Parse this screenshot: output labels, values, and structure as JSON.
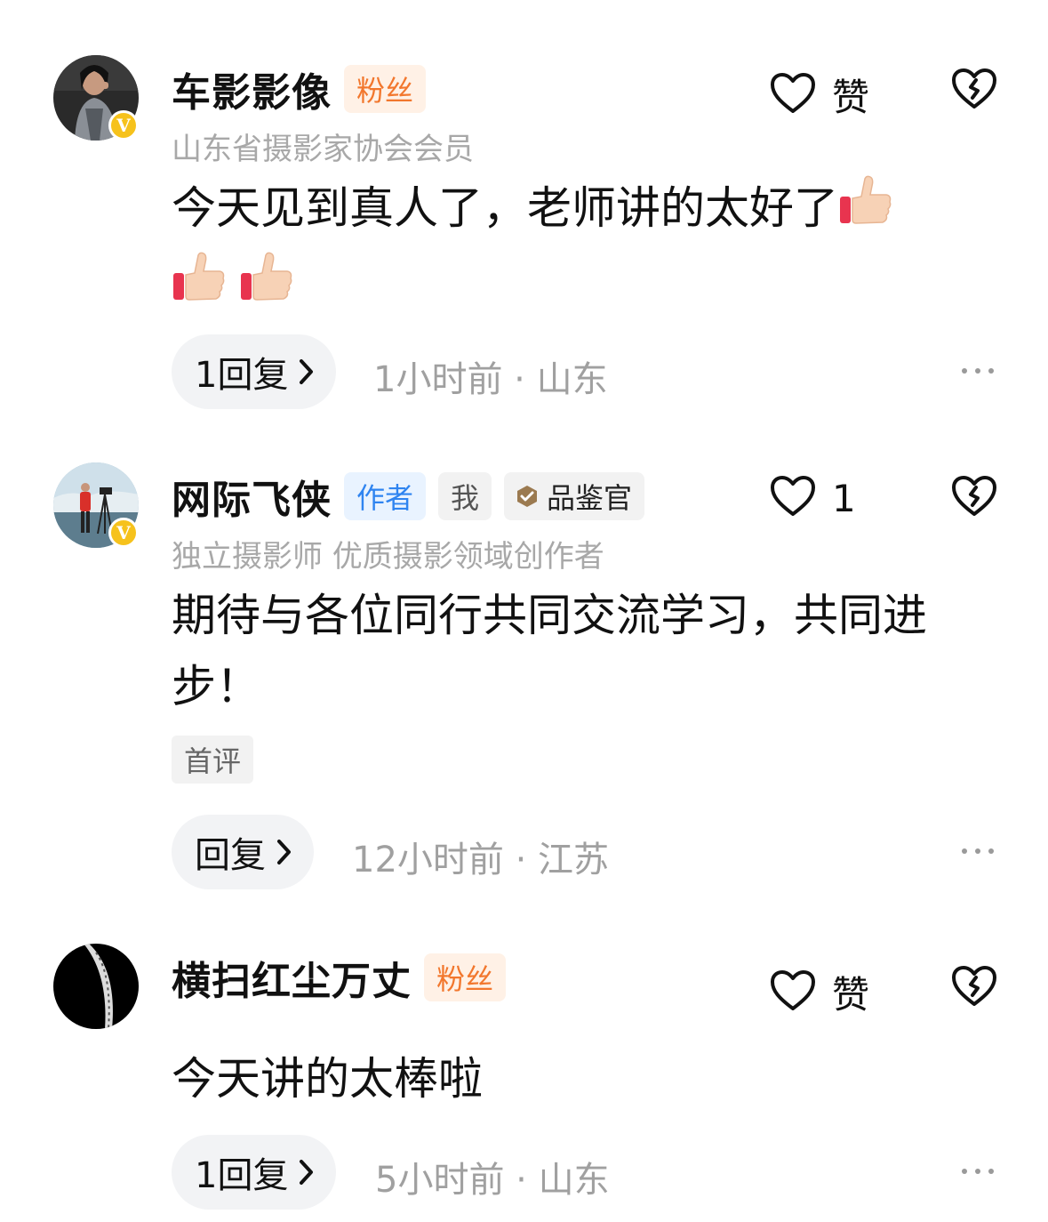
{
  "comments": [
    {
      "username": "车影影像",
      "tags": [
        "粉丝"
      ],
      "subtitle": "山东省摄影家协会会员",
      "text": "今天见到真人了，老师讲的太好了",
      "emoji": [
        "thumbs-up-icon",
        "thumbs-up-icon",
        "thumbs-up-icon"
      ],
      "like_label": "赞",
      "reply_label": "1回复",
      "meta": "1小时前 · 山东",
      "verified": true
    },
    {
      "username": "网际飞侠",
      "tags": [
        "作者",
        "我",
        "品鉴官"
      ],
      "subtitle": "独立摄影师 优质摄影领域创作者",
      "text": "期待与各位同行共同交流学习，共同进步！",
      "badge": "首评",
      "like_label": "1",
      "reply_label": "回复",
      "meta": "12小时前 · 江苏",
      "verified": true
    },
    {
      "username": "横扫红尘万丈",
      "tags": [
        "粉丝"
      ],
      "text": "今天讲的太棒啦",
      "like_label": "赞",
      "reply_label": "1回复",
      "meta": "5小时前 · 山东",
      "verified": false
    }
  ],
  "colors": {
    "fan_tag": "#f2772d",
    "author_tag": "#2f84f0",
    "verified_badge": "#f6c21c",
    "meta_text": "#a0a0a0"
  }
}
